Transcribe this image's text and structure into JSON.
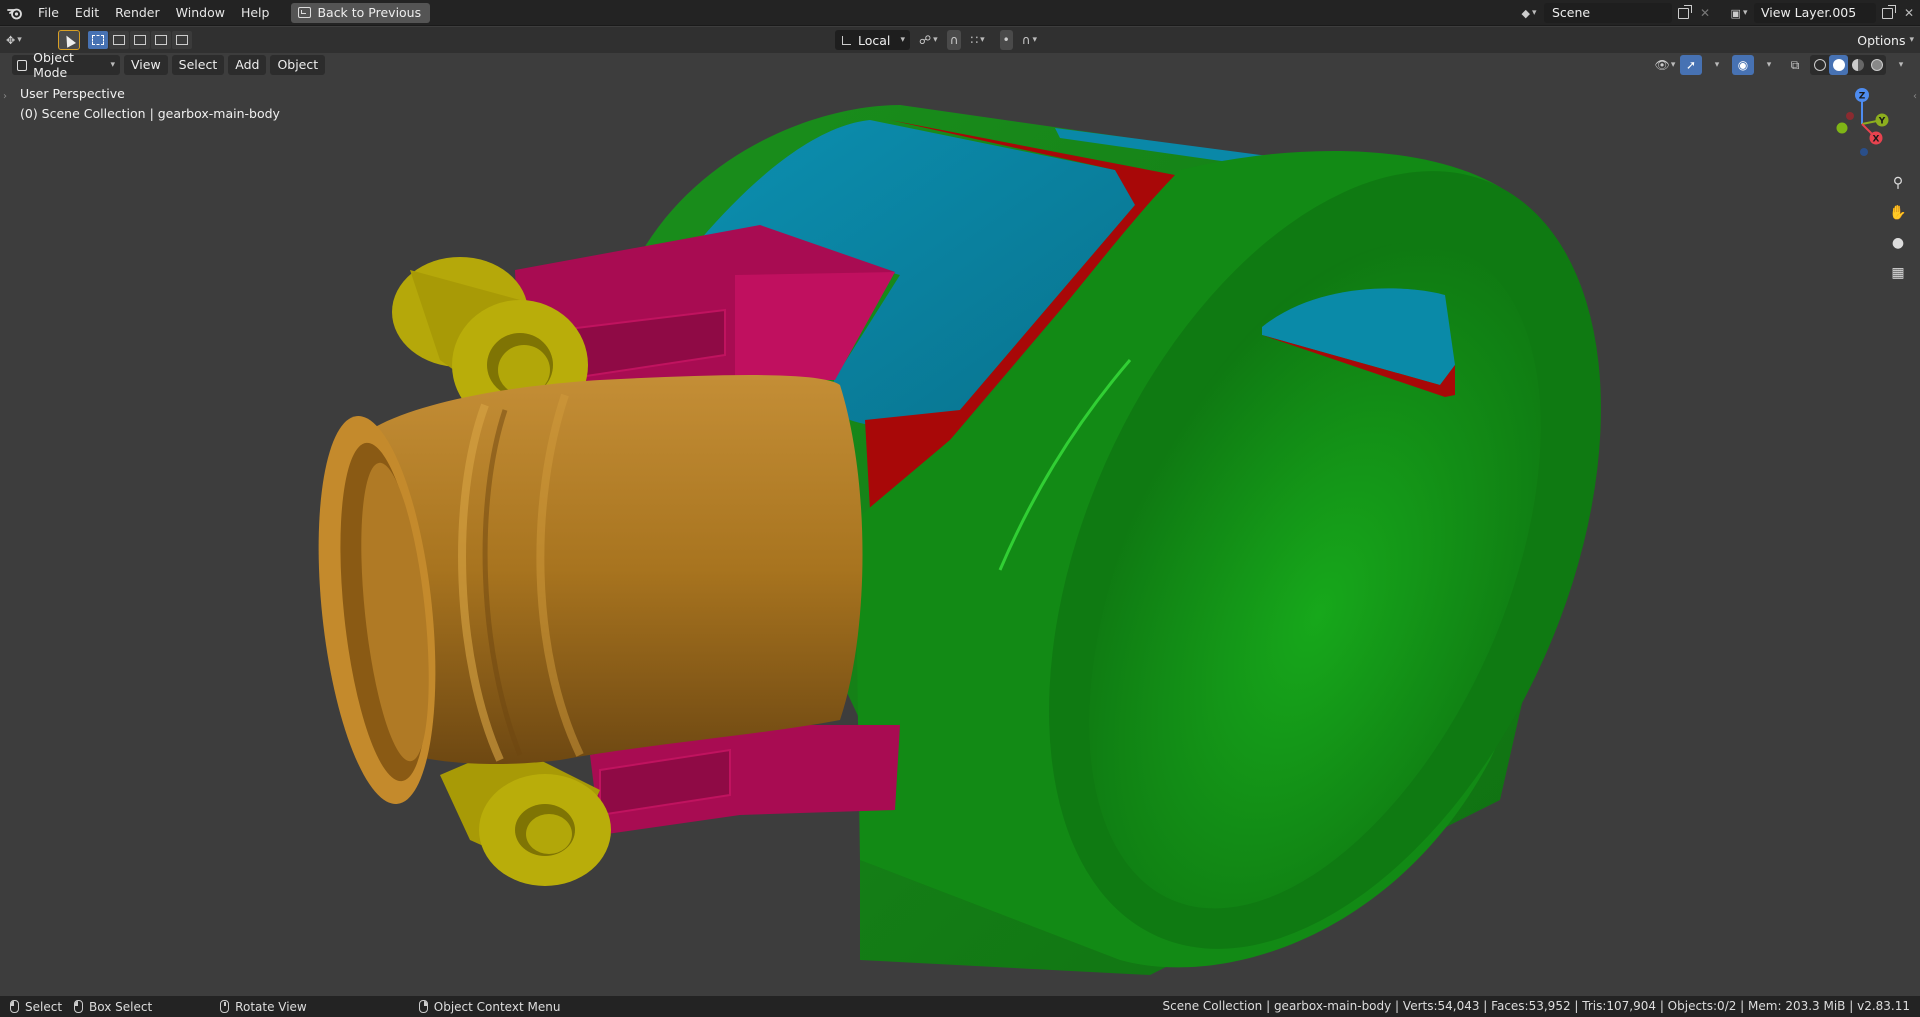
{
  "topbar": {
    "menus": [
      "File",
      "Edit",
      "Render",
      "Window",
      "Help"
    ],
    "back_label": "Back to Previous",
    "scene_name": "Scene",
    "view_layer": "View Layer.005"
  },
  "toolrow": {
    "orientation": "Local",
    "options_label": "Options"
  },
  "viewport": {
    "mode": "Object Mode",
    "menus": [
      "View",
      "Select",
      "Add",
      "Object"
    ],
    "perspective": "User Perspective",
    "collection_info": "(0) Scene Collection | gearbox-main-body",
    "gizmo_axes": {
      "z": "Z",
      "y": "Y",
      "x": "X"
    },
    "part_colors": {
      "housing": "#16961a",
      "top_plate": "#0a88a8",
      "seal": "#b40a0a",
      "bracket": "#a80c52",
      "flange_tube": "#b07a25",
      "bosses": "#b5a80a"
    }
  },
  "statusbar": {
    "select": "Select",
    "box_select": "Box Select",
    "rotate_view": "Rotate View",
    "context_menu": "Object Context Menu",
    "stats": "Scene Collection | gearbox-main-body | Verts:54,043 | Faces:53,952 | Tris:107,904 | Objects:0/2 | Mem: 203.3 MiB | v2.83.11"
  }
}
